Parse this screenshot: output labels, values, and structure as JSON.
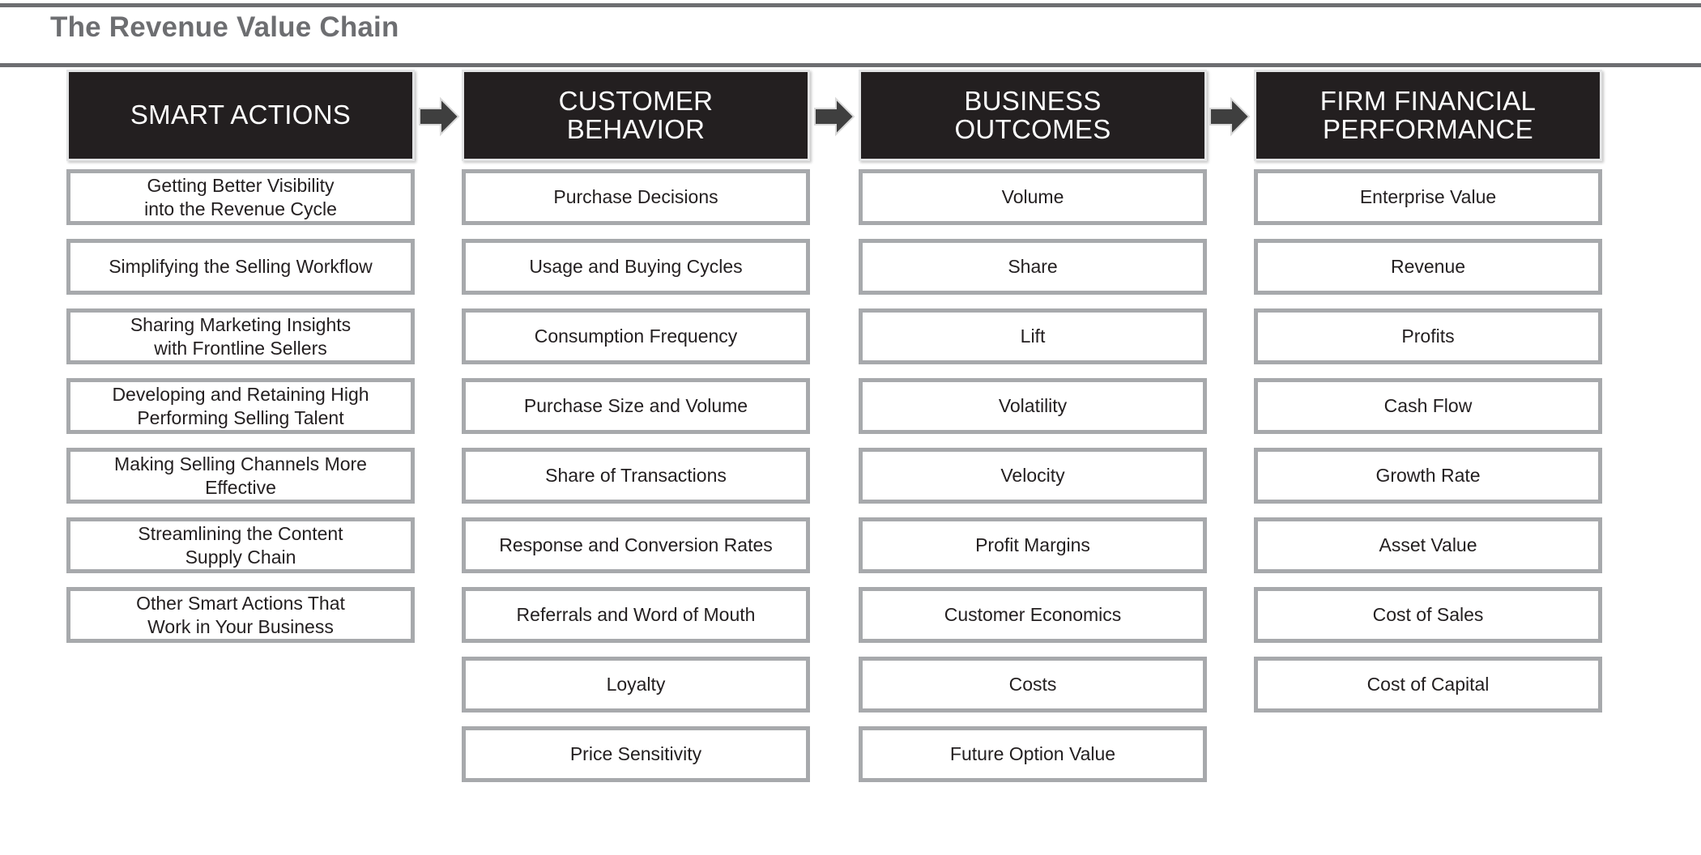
{
  "page": {
    "title": "The Revenue Value Chain",
    "accent_dark": "#231f20",
    "accent_gray": "#a7a9ac",
    "title_color": "#6d6e71",
    "arrow_color": "#3f3f3f"
  },
  "arrows": [
    {
      "name": "arrow-smart-actions-to-customer-behavior",
      "glyph": "right-arrow-icon"
    },
    {
      "name": "arrow-customer-behavior-to-business-outcomes",
      "glyph": "right-arrow-icon"
    },
    {
      "name": "arrow-business-outcomes-to-firm-financial-performance",
      "glyph": "right-arrow-icon"
    }
  ],
  "columns": [
    {
      "id": "smart-actions",
      "header_lines": [
        "SMART ACTIONS"
      ],
      "items": [
        [
          "Getting Better Visibility",
          "into the Revenue Cycle"
        ],
        [
          "Simplifying the Selling Workflow"
        ],
        [
          "Sharing Marketing Insights",
          "with Frontline Sellers"
        ],
        [
          "Developing and Retaining High",
          "Performing Selling Talent"
        ],
        [
          "Making Selling Channels More",
          "Effective"
        ],
        [
          "Streamlining the Content",
          "Supply Chain"
        ],
        [
          "Other Smart Actions That",
          "Work in Your Business"
        ]
      ]
    },
    {
      "id": "customer-behavior",
      "header_lines": [
        "CUSTOMER",
        "BEHAVIOR"
      ],
      "items": [
        [
          "Purchase Decisions"
        ],
        [
          "Usage and Buying Cycles"
        ],
        [
          "Consumption Frequency"
        ],
        [
          "Purchase Size and Volume"
        ],
        [
          "Share of Transactions"
        ],
        [
          "Response and Conversion Rates"
        ],
        [
          "Referrals and Word of Mouth"
        ],
        [
          "Loyalty"
        ],
        [
          "Price Sensitivity"
        ]
      ]
    },
    {
      "id": "business-outcomes",
      "header_lines": [
        "BUSINESS",
        "OUTCOMES"
      ],
      "items": [
        [
          "Volume"
        ],
        [
          "Share"
        ],
        [
          "Lift"
        ],
        [
          "Volatility"
        ],
        [
          "Velocity"
        ],
        [
          "Profit Margins"
        ],
        [
          "Customer Economics"
        ],
        [
          "Costs"
        ],
        [
          "Future Option Value"
        ]
      ]
    },
    {
      "id": "firm-financial-performance",
      "header_lines": [
        "FIRM FINANCIAL",
        "PERFORMANCE"
      ],
      "items": [
        [
          "Enterprise Value"
        ],
        [
          "Revenue"
        ],
        [
          "Profits"
        ],
        [
          "Cash Flow"
        ],
        [
          "Growth Rate"
        ],
        [
          "Asset Value"
        ],
        [
          "Cost of Sales"
        ],
        [
          "Cost of Capital"
        ]
      ]
    }
  ]
}
